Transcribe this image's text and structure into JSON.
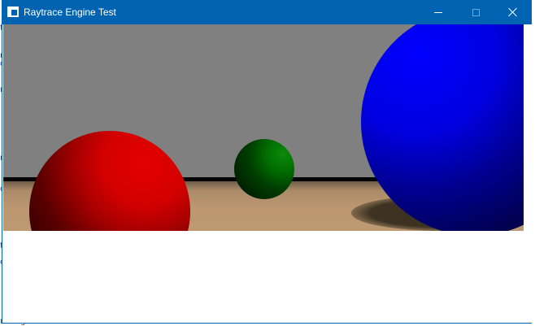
{
  "window": {
    "title": "Raytrace Engine Test",
    "icon": "app-window-icon",
    "accent_color": "#0063b1"
  },
  "titlebar_buttons": {
    "minimize": "minimize-icon",
    "maximize": "maximize-icon",
    "close": "close-icon"
  },
  "render": {
    "scene": {
      "background_wall_color": "#808080",
      "floor_color": "#bb9670",
      "spheres": [
        {
          "name": "red",
          "color": "#d20000"
        },
        {
          "name": "green",
          "color": "#006e00"
        },
        {
          "name": "blue",
          "color": "#0000f0"
        }
      ]
    }
  },
  "background_window": {
    "status_fragment": "neEngine",
    "status_arrow": "«"
  }
}
